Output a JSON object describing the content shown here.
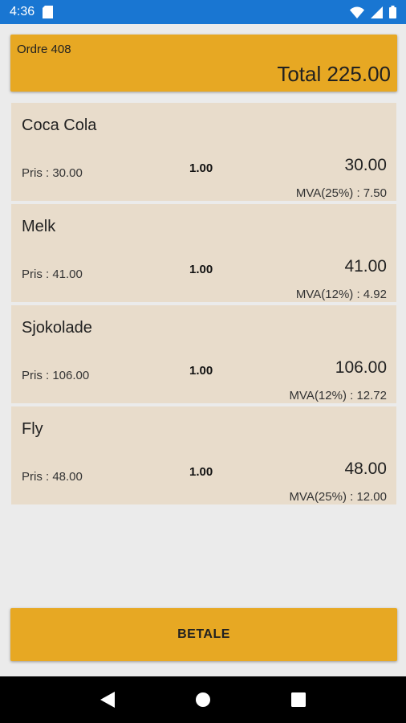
{
  "status_bar": {
    "time": "4:36",
    "icons": [
      "sd-card-icon",
      "wifi-icon",
      "signal-icon",
      "battery-icon"
    ]
  },
  "header": {
    "order": "Ordre 408",
    "total": "Total 225.00"
  },
  "items": [
    {
      "name": "Coca Cola",
      "price": "Pris : 30.00",
      "qty": "1.00",
      "amount": "30.00",
      "vat": "MVA(25%) : 7.50"
    },
    {
      "name": "Melk",
      "price": "Pris : 41.00",
      "qty": "1.00",
      "amount": "41.00",
      "vat": "MVA(12%) : 4.92"
    },
    {
      "name": "Sjokolade",
      "price": "Pris : 106.00",
      "qty": "1.00",
      "amount": "106.00",
      "vat": "MVA(12%) : 12.72"
    },
    {
      "name": "Fly",
      "price": "Pris : 48.00",
      "qty": "1.00",
      "amount": "48.00",
      "vat": "MVA(25%) : 12.00"
    }
  ],
  "pay_button": {
    "label": "BETALE"
  },
  "nav": {
    "icons": [
      "back-icon",
      "home-icon",
      "recents-icon"
    ]
  },
  "colors": {
    "status_bar": "#1976d2",
    "accent": "#e7a823",
    "item_bg": "#e8dccb",
    "page_bg": "#ebebeb"
  }
}
